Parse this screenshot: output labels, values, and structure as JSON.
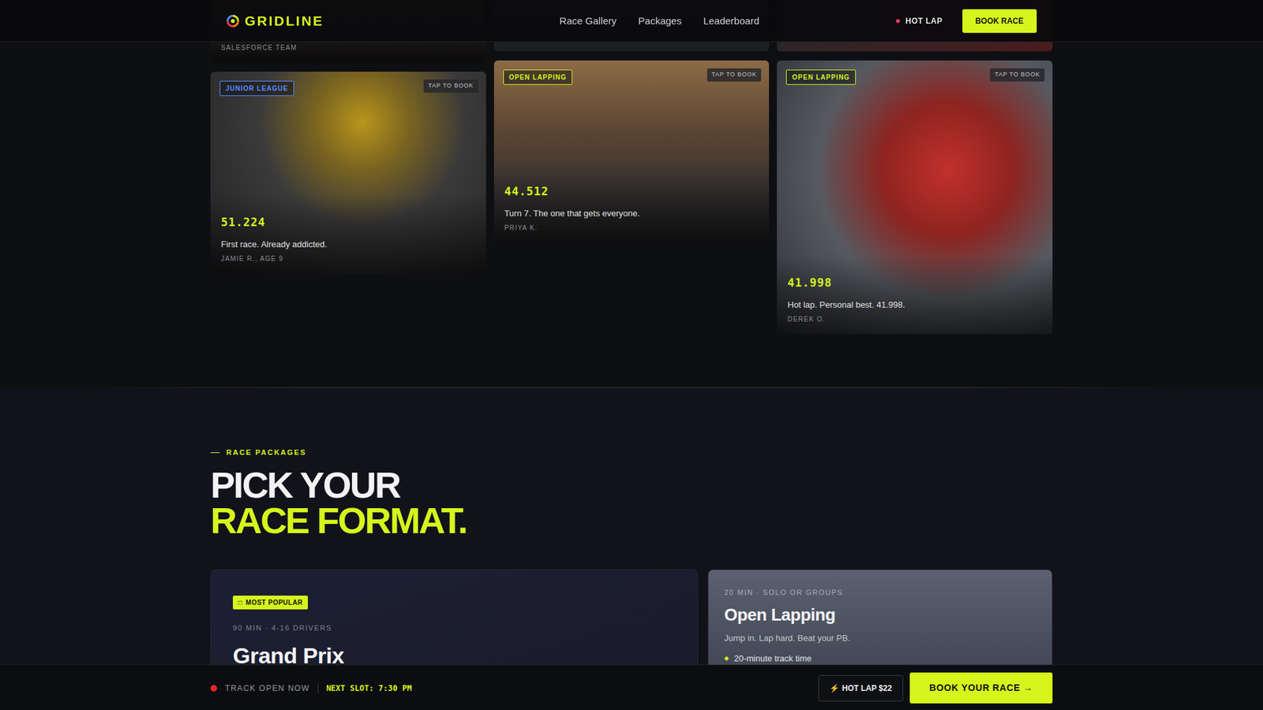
{
  "nav": {
    "brand": "GRIDLINE",
    "links": [
      {
        "label": "Race Gallery"
      },
      {
        "label": "Packages"
      },
      {
        "label": "Leaderboard"
      }
    ],
    "hot_lap": {
      "label": "HOT LAP",
      "live": true
    },
    "cta": "BOOK RACE"
  },
  "gallery": {
    "columns": [
      {
        "cards": [
          {
            "kind": "cut",
            "author": "SALESFORCE TEAM"
          },
          {
            "kind": "full",
            "tag": {
              "label": "JUNIOR LEAGUE",
              "color": "#5b8cff"
            },
            "action": "TAP TO BOOK",
            "time": "51.224",
            "caption": "First race. Already addicted.",
            "author": "JAMIE R., AGE 9"
          }
        ]
      },
      {
        "cards": [
          {
            "kind": "cut"
          },
          {
            "kind": "full",
            "tag": {
              "label": "OPEN LAPPING",
              "color": "#d6f51c"
            },
            "action": "TAP TO BOOK",
            "time": "44.512",
            "caption": "Turn 7. The one that gets everyone.",
            "author": "PRIYA K."
          }
        ]
      },
      {
        "cards": [
          {
            "kind": "cut"
          },
          {
            "kind": "full",
            "tag": {
              "label": "OPEN LAPPING",
              "color": "#d6f51c"
            },
            "action": "TAP TO BOOK",
            "time": "41.998",
            "caption": "Hot lap. Personal best. 41.998.",
            "author": "DEREK O."
          }
        ]
      }
    ]
  },
  "packages": {
    "eyebrow": "RACE PACKAGES",
    "title_line1": "PICK YOUR",
    "title_line2": "RACE FORMAT.",
    "items": [
      {
        "featured": true,
        "badge": {
          "icon": "□",
          "label": "MOST POPULAR"
        },
        "meta": "90 MIN · 4-16 DRIVERS",
        "name": "Grand Prix"
      },
      {
        "featured": false,
        "meta": "20 MIN · SOLO OR GROUPS",
        "name": "Open Lapping",
        "tagline": "Jump in. Lap hard. Beat your PB.",
        "features": [
          {
            "bullet": "◆",
            "label": "20-minute track time"
          }
        ]
      }
    ]
  },
  "bottom_bar": {
    "status": "TRACK OPEN NOW",
    "open": true,
    "next_slot": "NEXT SLOT: 7:30 PM",
    "hot_lap_button": {
      "icon": "⚡",
      "label": "HOT LAP $22"
    },
    "book_button": "BOOK YOUR RACE →"
  }
}
